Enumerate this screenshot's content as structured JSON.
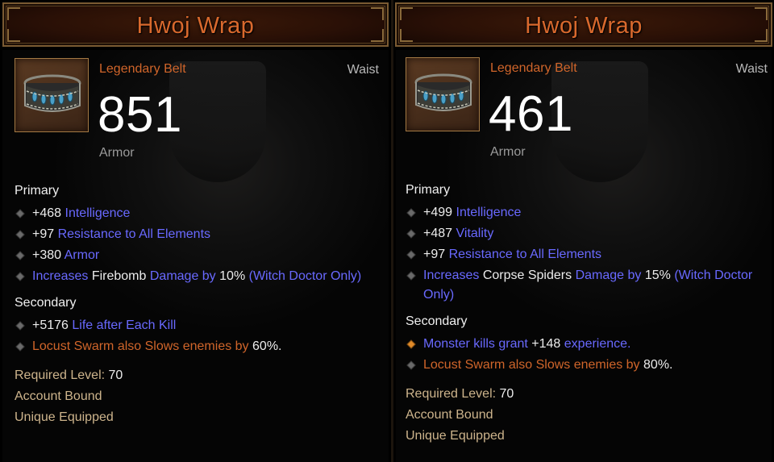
{
  "cards": [
    {
      "title": "Hwoj Wrap",
      "item_type": "Legendary Belt",
      "slot": "Waist",
      "armor_value": "851",
      "armor_label": "Armor",
      "primary_label": "Primary",
      "primary": [
        {
          "value": "+468",
          "stat": "Intelligence"
        },
        {
          "value": "+97",
          "stat": "Resistance to All Elements"
        },
        {
          "value": "+380",
          "stat": "Armor"
        }
      ],
      "primary_skill": {
        "prefix": "Increases",
        "skill": "Firebomb",
        "stat": "Damage by",
        "amount": "10%",
        "restriction": "(Witch Doctor Only)"
      },
      "secondary_label": "Secondary",
      "secondary_first": {
        "value": "+5176",
        "stat": "Life after Each Kill"
      },
      "legendary_affix": {
        "text": "Locust Swarm also Slows enemies by",
        "amount": "60%",
        "suffix": "."
      },
      "required_label": "Required Level:",
      "required_level": "70",
      "account_bound": "Account Bound",
      "unique_equipped": "Unique Equipped"
    },
    {
      "title": "Hwoj Wrap",
      "item_type": "Legendary Belt",
      "slot": "Waist",
      "armor_value": "461",
      "armor_label": "Armor",
      "primary_label": "Primary",
      "primary": [
        {
          "value": "+499",
          "stat": "Intelligence"
        },
        {
          "value": "+487",
          "stat": "Vitality"
        },
        {
          "value": "+97",
          "stat": "Resistance to All Elements"
        }
      ],
      "primary_skill": {
        "prefix": "Increases",
        "skill": "Corpse Spiders",
        "stat": "Damage by",
        "amount": "15%",
        "restriction_1": "(Witch Doctor",
        "restriction_2": "Only)"
      },
      "secondary_label": "Secondary",
      "secondary_first": {
        "prefix": "Monster kills grant",
        "value": "+148",
        "suffix": "experience."
      },
      "legendary_affix": {
        "text": "Locust Swarm also Slows enemies by",
        "amount": "80%",
        "suffix": "."
      },
      "required_label": "Required Level:",
      "required_level": "70",
      "account_bound": "Account Bound",
      "unique_equipped": "Unique Equipped"
    }
  ],
  "colors": {
    "title": "#d9692d",
    "legendary": "#d0652a",
    "magic_stat": "#6969ff",
    "white": "#ececec",
    "meta": "#cdb48c",
    "bullet": "#6a6a6a",
    "bullet_gold": "#e08a2a"
  },
  "icons": {
    "item": "belt-icon",
    "bullet": "diamond-bullet-icon",
    "bullet_gold": "gold-diamond-bullet-icon"
  }
}
